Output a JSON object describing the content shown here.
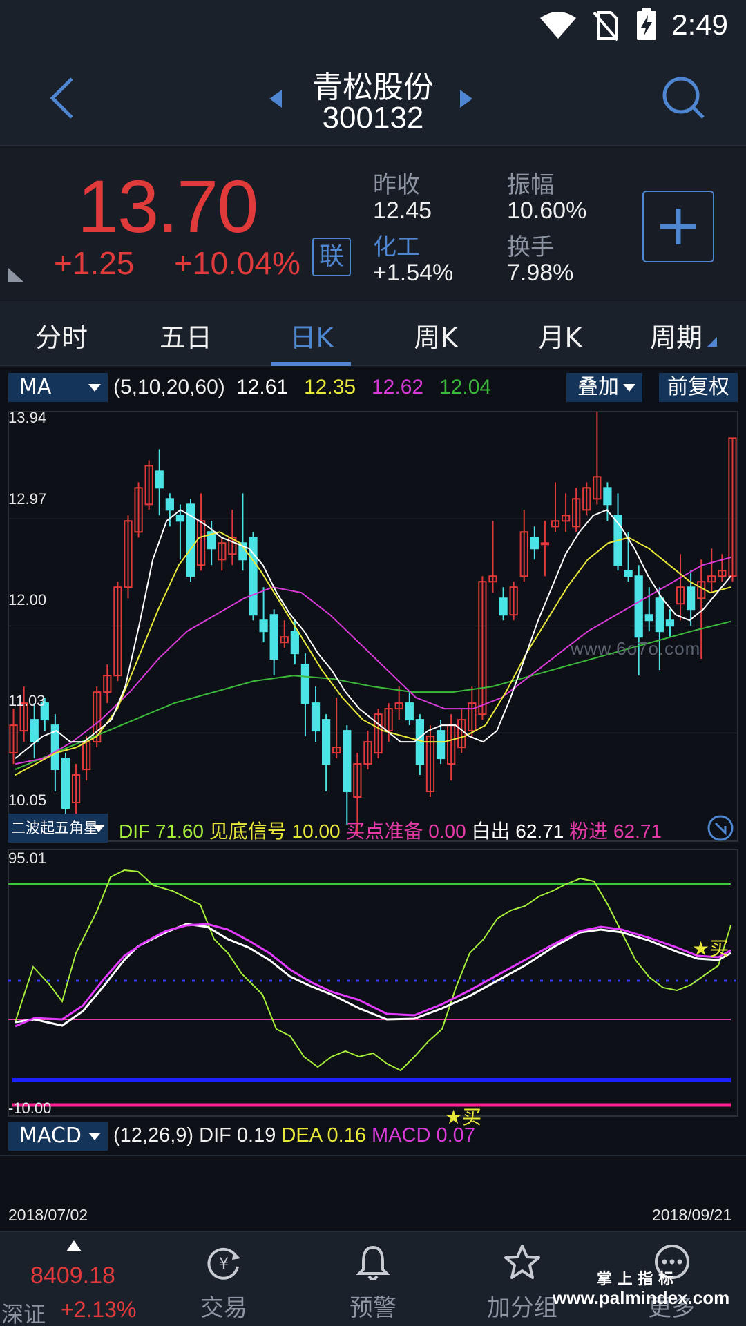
{
  "status": {
    "time": "2:49"
  },
  "header": {
    "stock_name": "青松股份",
    "stock_code": "300132"
  },
  "quote": {
    "price": "13.70",
    "change": "+1.25",
    "change_pct": "+10.04%",
    "link_badge": "联",
    "prev_close_label": "昨收",
    "prev_close": "12.45",
    "sector_label": "化工",
    "sector_change": "+1.54%",
    "amplitude_label": "振幅",
    "amplitude": "10.60%",
    "turnover_label": "换手",
    "turnover": "7.98%"
  },
  "tabs": [
    {
      "label": "分时"
    },
    {
      "label": "五日"
    },
    {
      "label": "日K"
    },
    {
      "label": "周K"
    },
    {
      "label": "月K"
    },
    {
      "label": "周期"
    }
  ],
  "active_tab": "日K",
  "ma_bar": {
    "selector": "MA",
    "params": "(5,10,20,60)",
    "ma5": "12.61",
    "ma10": "12.35",
    "ma20": "12.62",
    "ma60": "12.04",
    "overlay_button": "叠加",
    "adjust_button": "前复权"
  },
  "price_axis": {
    "top": "13.94",
    "l2": "12.97",
    "l3": "12.00",
    "l4": "11.03",
    "bottom": "10.05"
  },
  "watermark_center": "www.6o7o.com",
  "indicator_bar": {
    "selector": "二波起五角星",
    "dif_label": "DIF",
    "dif": "71.60",
    "bottom_label": "见底信号",
    "bottom": "10.00",
    "buy_label": "买点准备",
    "buy": "0.00",
    "white_label": "白出",
    "white": "62.71",
    "pink_label": "粉进",
    "pink": "62.71"
  },
  "indicator_axis": {
    "top": "95.01",
    "bottom": "-10.00"
  },
  "buy_marker": "★买",
  "macd_bar": {
    "selector": "MACD",
    "params": "(12,26,9)",
    "dif_label": "DIF",
    "dif": "0.19",
    "dea_label": "DEA",
    "dea": "0.16",
    "macd_label": "MACD",
    "macd": "0.07"
  },
  "dates": {
    "start": "2018/07/02",
    "end": "2018/09/21"
  },
  "bottom_nav": {
    "index_value": "8409.18",
    "index_name": "深证",
    "index_change": "+2.13%",
    "trade": "交易",
    "alert": "预警",
    "group": "加分组",
    "more": "更多"
  },
  "watermark_bottom": {
    "line1": "掌 上 指 标",
    "line2": "www.palmindex.com"
  },
  "colors": {
    "up": "#e03a3a",
    "down": "#4be3e6",
    "ma5": "#ffffff",
    "ma10": "#e8e83a",
    "ma20": "#d83ad8",
    "ma60": "#3cb83c",
    "accent": "#4f86d1"
  },
  "chart_data": {
    "type": "candlestick",
    "x_range": [
      "2018/07/02",
      "2018/09/21"
    ],
    "ylim": [
      10.05,
      13.94
    ],
    "y_ticks": [
      13.94,
      12.97,
      12.0,
      11.03,
      10.05
    ],
    "candles": [
      {
        "o": 10.85,
        "c": 11.1,
        "h": 11.25,
        "l": 10.75
      },
      {
        "o": 11.05,
        "c": 11.3,
        "h": 11.45,
        "l": 10.95
      },
      {
        "o": 11.15,
        "c": 10.95,
        "h": 11.3,
        "l": 10.8
      },
      {
        "o": 11.3,
        "c": 11.15,
        "h": 11.35,
        "l": 11.05
      },
      {
        "o": 11.1,
        "c": 10.7,
        "h": 11.2,
        "l": 10.5
      },
      {
        "o": 10.8,
        "c": 10.35,
        "h": 10.85,
        "l": 10.2
      },
      {
        "o": 10.4,
        "c": 10.65,
        "h": 10.75,
        "l": 10.1
      },
      {
        "o": 10.7,
        "c": 10.95,
        "h": 11.0,
        "l": 10.6
      },
      {
        "o": 10.95,
        "c": 11.4,
        "h": 11.45,
        "l": 10.9
      },
      {
        "o": 11.4,
        "c": 11.55,
        "h": 11.65,
        "l": 11.3
      },
      {
        "o": 11.55,
        "c": 12.35,
        "h": 12.4,
        "l": 11.5
      },
      {
        "o": 12.35,
        "c": 12.95,
        "h": 13.0,
        "l": 12.25
      },
      {
        "o": 12.85,
        "c": 13.25,
        "h": 13.3,
        "l": 12.8
      },
      {
        "o": 13.1,
        "c": 13.45,
        "h": 13.5,
        "l": 13.05
      },
      {
        "o": 13.4,
        "c": 13.25,
        "h": 13.6,
        "l": 13.0
      },
      {
        "o": 13.15,
        "c": 13.05,
        "h": 13.2,
        "l": 12.9
      },
      {
        "o": 13.0,
        "c": 12.95,
        "h": 13.1,
        "l": 12.6
      },
      {
        "o": 13.1,
        "c": 12.45,
        "h": 13.15,
        "l": 12.4
      },
      {
        "o": 12.55,
        "c": 12.95,
        "h": 13.2,
        "l": 12.5
      },
      {
        "o": 12.85,
        "c": 12.7,
        "h": 12.95,
        "l": 12.55
      },
      {
        "o": 12.6,
        "c": 12.75,
        "h": 12.8,
        "l": 12.5
      },
      {
        "o": 12.65,
        "c": 12.8,
        "h": 13.05,
        "l": 12.55
      },
      {
        "o": 12.75,
        "c": 12.6,
        "h": 13.2,
        "l": 12.5
      },
      {
        "o": 12.8,
        "c": 12.1,
        "h": 12.85,
        "l": 12.05
      },
      {
        "o": 12.05,
        "c": 11.95,
        "h": 12.35,
        "l": 11.85
      },
      {
        "o": 12.1,
        "c": 11.7,
        "h": 12.15,
        "l": 11.55
      },
      {
        "o": 11.85,
        "c": 11.9,
        "h": 12.05,
        "l": 11.8
      },
      {
        "o": 11.95,
        "c": 11.75,
        "h": 12.05,
        "l": 11.65
      },
      {
        "o": 11.65,
        "c": 11.3,
        "h": 11.75,
        "l": 11.0
      },
      {
        "o": 11.3,
        "c": 11.05,
        "h": 11.45,
        "l": 10.95
      },
      {
        "o": 11.15,
        "c": 10.75,
        "h": 11.2,
        "l": 10.5
      },
      {
        "o": 10.85,
        "c": 10.9,
        "h": 11.35,
        "l": 10.8
      },
      {
        "o": 11.05,
        "c": 10.5,
        "h": 11.1,
        "l": 10.2
      },
      {
        "o": 10.45,
        "c": 10.75,
        "h": 10.85,
        "l": 10.1
      },
      {
        "o": 10.75,
        "c": 10.95,
        "h": 11.05,
        "l": 10.7
      },
      {
        "o": 10.85,
        "c": 11.2,
        "h": 11.25,
        "l": 10.8
      },
      {
        "o": 11.05,
        "c": 11.25,
        "h": 11.3,
        "l": 10.95
      },
      {
        "o": 11.25,
        "c": 11.3,
        "h": 11.45,
        "l": 11.15
      },
      {
        "o": 11.3,
        "c": 11.15,
        "h": 11.4,
        "l": 11.1
      },
      {
        "o": 11.15,
        "c": 10.75,
        "h": 11.2,
        "l": 10.65
      },
      {
        "o": 10.5,
        "c": 11.0,
        "h": 11.1,
        "l": 10.45
      },
      {
        "o": 11.05,
        "c": 10.8,
        "h": 11.15,
        "l": 10.75
      },
      {
        "o": 10.75,
        "c": 11.1,
        "h": 11.2,
        "l": 10.6
      },
      {
        "o": 10.9,
        "c": 11.15,
        "h": 11.25,
        "l": 10.85
      },
      {
        "o": 11.05,
        "c": 11.3,
        "h": 11.45,
        "l": 11.0
      },
      {
        "o": 11.2,
        "c": 12.4,
        "h": 12.45,
        "l": 11.15
      },
      {
        "o": 12.4,
        "c": 12.45,
        "h": 12.95,
        "l": 12.3
      },
      {
        "o": 12.25,
        "c": 12.1,
        "h": 12.35,
        "l": 12.05
      },
      {
        "o": 12.1,
        "c": 12.35,
        "h": 12.4,
        "l": 12.05
      },
      {
        "o": 12.45,
        "c": 12.85,
        "h": 13.05,
        "l": 12.4
      },
      {
        "o": 12.8,
        "c": 12.7,
        "h": 12.9,
        "l": 12.6
      },
      {
        "o": 12.75,
        "c": 12.75,
        "h": 12.95,
        "l": 12.45
      },
      {
        "o": 12.9,
        "c": 12.95,
        "h": 13.3,
        "l": 12.85
      },
      {
        "o": 12.95,
        "c": 13.0,
        "h": 13.2,
        "l": 12.85
      },
      {
        "o": 12.9,
        "c": 13.15,
        "h": 13.25,
        "l": 12.85
      },
      {
        "o": 13.05,
        "c": 13.25,
        "h": 13.3,
        "l": 13.0
      },
      {
        "o": 13.15,
        "c": 13.35,
        "h": 13.94,
        "l": 13.1
      },
      {
        "o": 13.25,
        "c": 13.1,
        "h": 13.3,
        "l": 12.95
      },
      {
        "o": 13.0,
        "c": 12.55,
        "h": 13.2,
        "l": 12.5
      },
      {
        "o": 12.5,
        "c": 12.45,
        "h": 12.85,
        "l": 12.4
      },
      {
        "o": 12.45,
        "c": 11.9,
        "h": 12.55,
        "l": 11.55
      },
      {
        "o": 12.1,
        "c": 12.05,
        "h": 12.35,
        "l": 11.95
      },
      {
        "o": 12.25,
        "c": 11.95,
        "h": 12.35,
        "l": 11.6
      },
      {
        "o": 12.05,
        "c": 12.0,
        "h": 12.15,
        "l": 11.9
      },
      {
        "o": 12.2,
        "c": 12.35,
        "h": 12.65,
        "l": 12.05
      },
      {
        "o": 12.35,
        "c": 12.15,
        "h": 12.5,
        "l": 12.0
      },
      {
        "o": 12.25,
        "c": 12.4,
        "h": 12.6,
        "l": 11.7
      },
      {
        "o": 12.4,
        "c": 12.45,
        "h": 12.7,
        "l": 12.3
      },
      {
        "o": 12.45,
        "c": 12.5,
        "h": 12.65,
        "l": 12.4
      },
      {
        "o": 12.45,
        "c": 13.7,
        "h": 13.7,
        "l": 12.4
      }
    ],
    "ma5": [
      10.8,
      10.9,
      11.0,
      11.05,
      10.95,
      10.95,
      11.05,
      11.15,
      11.45,
      12.0,
      12.6,
      12.95,
      13.05,
      12.98,
      12.9,
      12.8,
      12.75,
      12.7,
      12.55,
      12.3,
      12.1,
      11.95,
      11.75,
      11.6,
      11.4,
      11.25,
      11.15,
      11.05,
      10.95,
      10.95,
      11.05,
      11.1,
      11.1,
      11.0,
      10.95,
      11.05,
      11.35,
      11.7,
      12.05,
      12.35,
      12.65,
      12.85,
      13.0,
      13.05,
      12.9,
      12.7,
      12.45,
      12.25,
      12.1,
      12.05,
      12.15,
      12.3,
      12.45
    ],
    "ma10": [
      10.65,
      10.75,
      10.85,
      10.9,
      11.0,
      11.25,
      11.7,
      12.15,
      12.55,
      12.8,
      12.85,
      12.75,
      12.5,
      12.2,
      11.9,
      11.6,
      11.35,
      11.15,
      11.05,
      11.0,
      10.95,
      10.95,
      11.0,
      11.1,
      11.4,
      11.75,
      12.05,
      12.35,
      12.6,
      12.75,
      12.8,
      12.7,
      12.55,
      12.4,
      12.3,
      12.35
    ],
    "ma20": [
      10.75,
      10.8,
      10.95,
      11.15,
      11.4,
      11.7,
      11.95,
      12.1,
      12.25,
      12.35,
      12.3,
      12.1,
      11.85,
      11.6,
      11.35,
      11.25,
      11.25,
      11.35,
      11.55,
      11.75,
      11.95,
      12.1,
      12.25,
      12.4,
      12.55,
      12.62
    ],
    "ma60": [
      10.7,
      10.85,
      11.0,
      11.15,
      11.3,
      11.4,
      11.5,
      11.55,
      11.52,
      11.45,
      11.4,
      11.4,
      11.45,
      11.55,
      11.65,
      11.75,
      11.85,
      11.95,
      12.04
    ]
  }
}
